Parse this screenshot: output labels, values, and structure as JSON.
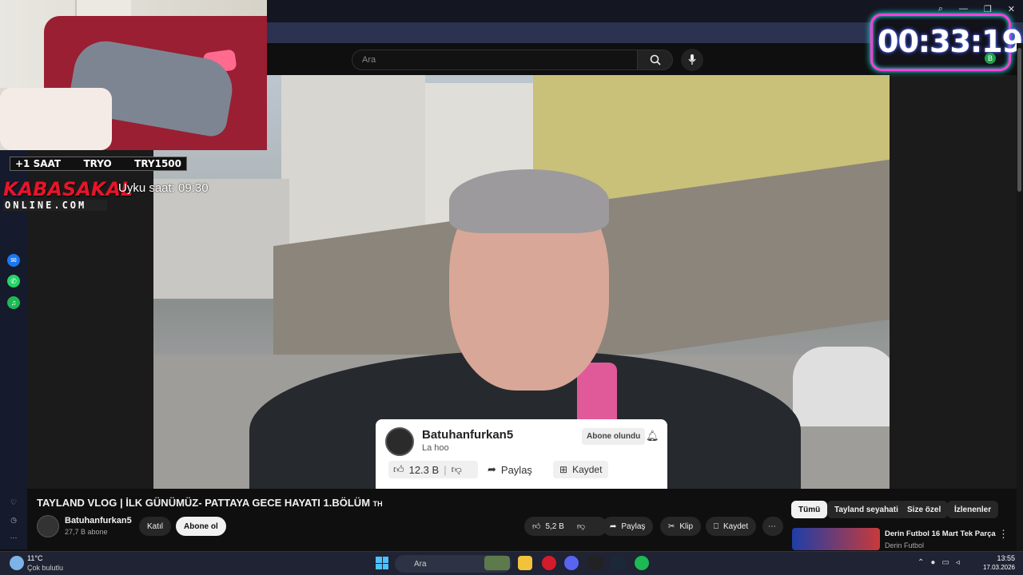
{
  "overlay": {
    "goals": [
      "+1 SAAT",
      "TRYO",
      "TRY1500"
    ],
    "brand_top": "KABASAKAL",
    "brand_bottom": "ONLINE.COM",
    "sleep_label": "Uyku saat: 09:30",
    "timer": "00:33:19",
    "timer_badge": "B"
  },
  "search": {
    "placeholder": "Ara"
  },
  "card": {
    "channel": "Batuhanfurkan5",
    "subtitle": "La hoo",
    "subscribed": "Abone olundu",
    "likes": "12.3 B",
    "share": "Paylaş",
    "save": "Kaydet"
  },
  "video": {
    "title": "TAYLAND VLOG | İLK GÜNÜMÜZ- PATTAYA GECE HAYATI 1.BÖLÜM",
    "title_suffix": "TH",
    "channel": "Batuhanfurkan5",
    "subscribers": "27,7 B abone",
    "join": "Katıl",
    "subscribe": "Abone ol",
    "likes": "5,2 B",
    "share": "Paylaş",
    "clip": "Klip",
    "save": "Kaydet"
  },
  "chips": [
    "Tümü",
    "Tayland seyahati",
    "Size özel",
    "İzlenenler"
  ],
  "recommended": {
    "title": "Derin Futbol 16 Mart Tek Parça",
    "channel": "Derin Futbol"
  },
  "taskbar": {
    "temp": "11°C",
    "condition": "Çok bulutlu",
    "search": "Ara",
    "time": "13:55",
    "date": "17.03.2026"
  },
  "colors": {
    "accent_brand": "#e8142a",
    "timer_border": "#ff3fd6",
    "timer_glow": "#22ffff"
  }
}
